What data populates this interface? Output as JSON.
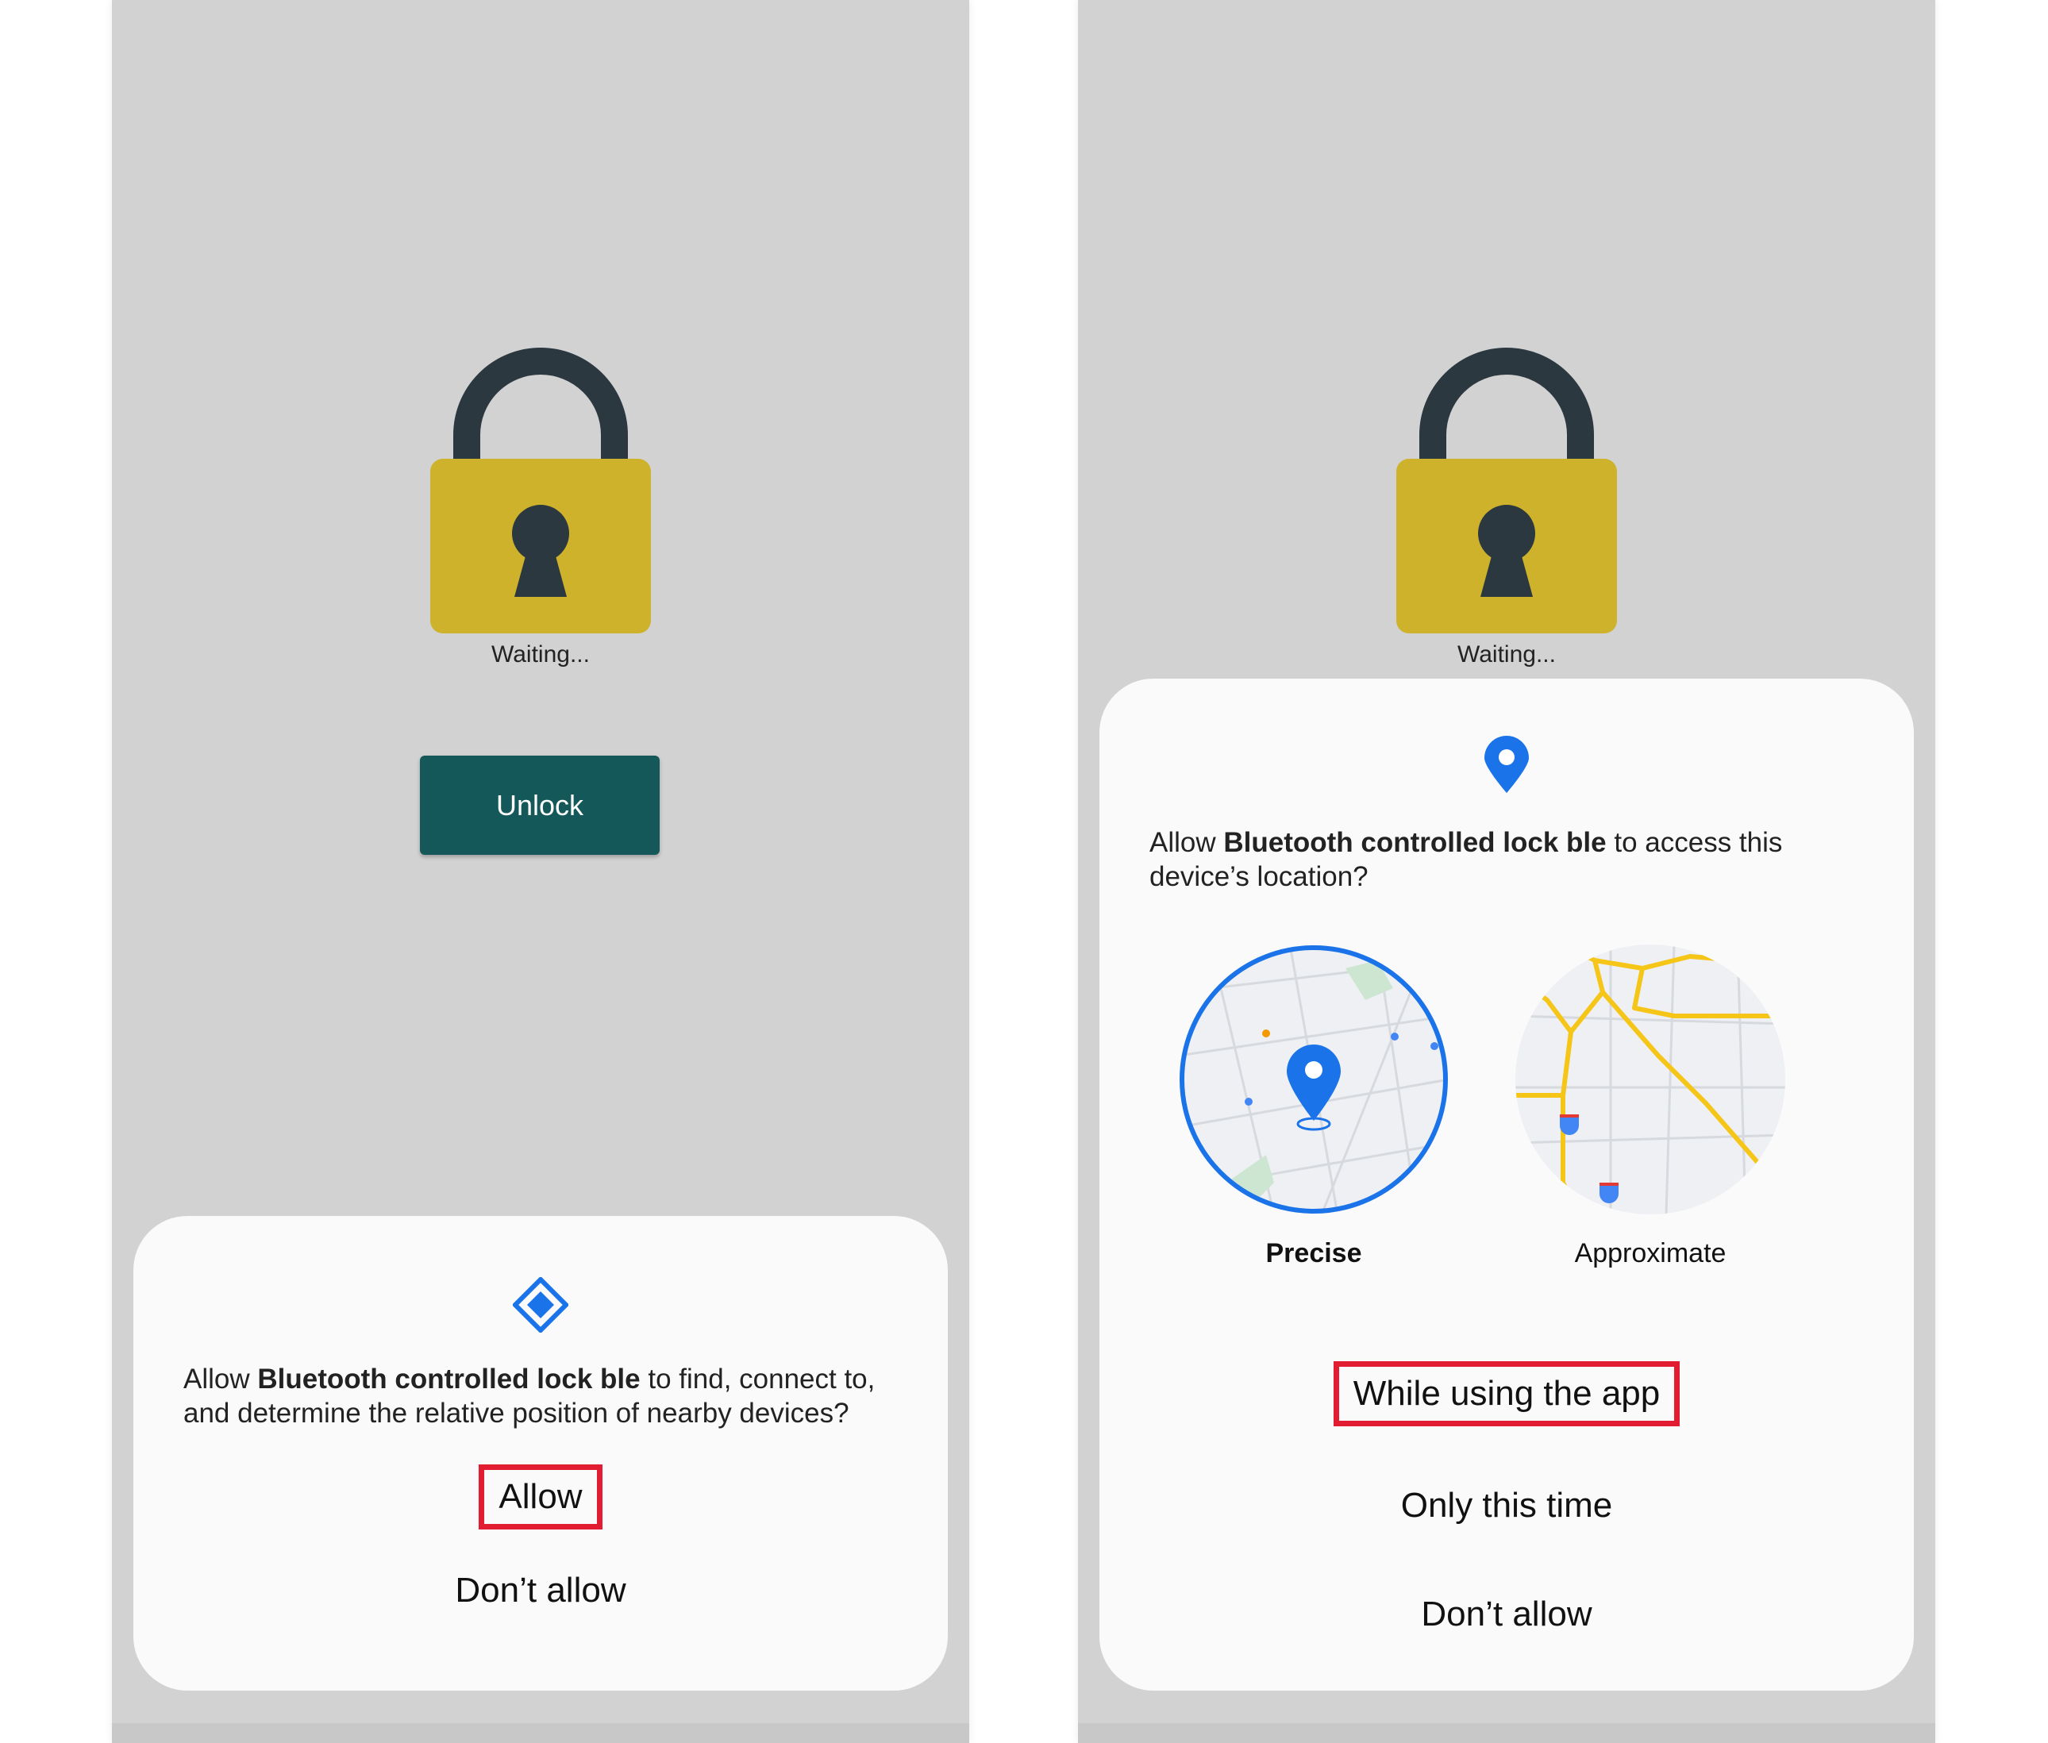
{
  "left_screen": {
    "status_text": "Waiting...",
    "unlock_button_label": "Unlock",
    "dialog": {
      "prompt_prefix": "Allow ",
      "app_name": "Bluetooth controlled lock ble",
      "prompt_suffix": " to find, connect to, and determine the relative position of nearby devices?",
      "allow_label": "Allow",
      "deny_label": "Don’t allow"
    }
  },
  "right_screen": {
    "status_text": "Waiting...",
    "dialog": {
      "prompt_prefix": "Allow ",
      "app_name": "Bluetooth controlled lock ble",
      "prompt_suffix": " to access this device’s location?",
      "precise_label": "Precise",
      "approximate_label": "Approximate",
      "while_using_label": "While using the app",
      "only_this_time_label": "Only this time",
      "deny_label": "Don’t allow"
    }
  },
  "colors": {
    "lock_body": "#cfb22b",
    "lock_shackle": "#2b3840",
    "unlock_button": "#14585a",
    "accent_blue": "#1a73e8",
    "highlight_red": "#e21d32",
    "route_yellow": "#f5c518"
  },
  "icons": {
    "left_dialog_icon": "nearby-devices-icon",
    "right_dialog_icon": "location-pin-icon"
  }
}
